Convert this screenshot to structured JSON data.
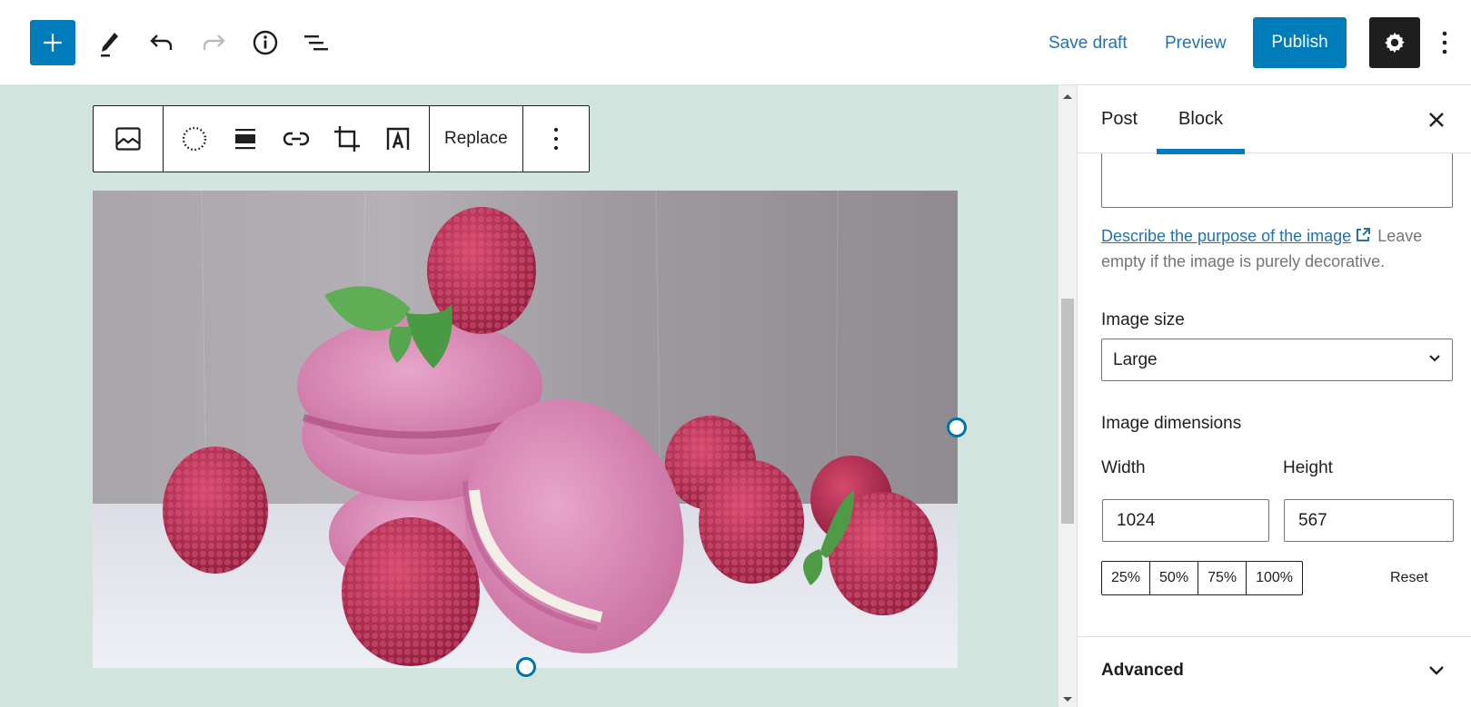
{
  "header": {
    "inserter_icon": "plus-icon",
    "tools": [
      {
        "name": "edit-mode-button",
        "icon": "pencil-icon"
      },
      {
        "name": "undo-button",
        "icon": "undo-icon"
      },
      {
        "name": "redo-button",
        "icon": "redo-icon",
        "disabled": true
      },
      {
        "name": "details-button",
        "icon": "info-icon"
      },
      {
        "name": "list-view-button",
        "icon": "list-view-icon"
      }
    ],
    "save_draft_label": "Save draft",
    "preview_label": "Preview",
    "publish_label": "Publish",
    "settings_icon": "gear-icon",
    "more_icon": "more-vertical-icon",
    "accent_color": "#007cba"
  },
  "block_toolbar": {
    "block_type_icon": "image-icon",
    "tools": [
      "duotone-icon",
      "align-icon",
      "link-icon",
      "crop-icon",
      "text-overlay-icon"
    ],
    "replace_label": "Replace",
    "more_icon": "more-vertical-icon"
  },
  "canvas": {
    "background": "#d1e4dd",
    "image_description": "Pink macarons with raspberries and mint leaves"
  },
  "sidebar": {
    "tabs": [
      {
        "label": "Post",
        "active": false
      },
      {
        "label": "Block",
        "active": true
      }
    ],
    "close_icon": "close-icon",
    "alt_text_value": "",
    "help_link": "Describe the purpose of the image",
    "help_text": "Leave empty if the image is purely decorative.",
    "image_size_label": "Image size",
    "image_size_value": "Large",
    "image_dimensions_label": "Image dimensions",
    "width_label": "Width",
    "width_value": "1024",
    "height_label": "Height",
    "height_value": "567",
    "scale_buttons": [
      "25%",
      "50%",
      "75%",
      "100%"
    ],
    "reset_label": "Reset",
    "advanced_label": "Advanced"
  }
}
